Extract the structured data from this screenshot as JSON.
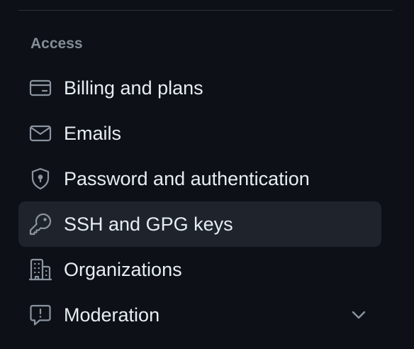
{
  "sidebar": {
    "section_title": "Access",
    "items": [
      {
        "label": "Billing and plans",
        "icon": "credit-card-icon",
        "active": false
      },
      {
        "label": "Emails",
        "icon": "mail-icon",
        "active": false
      },
      {
        "label": "Password and authentication",
        "icon": "shield-lock-icon",
        "active": false
      },
      {
        "label": "SSH and GPG keys",
        "icon": "key-icon",
        "active": true
      },
      {
        "label": "Organizations",
        "icon": "organization-icon",
        "active": false
      },
      {
        "label": "Moderation",
        "icon": "report-icon",
        "active": false,
        "expandable": true
      }
    ]
  },
  "colors": {
    "background": "#0d1117",
    "active_background": "#1f242c",
    "text": "#e6edf3",
    "muted": "#848d97"
  }
}
